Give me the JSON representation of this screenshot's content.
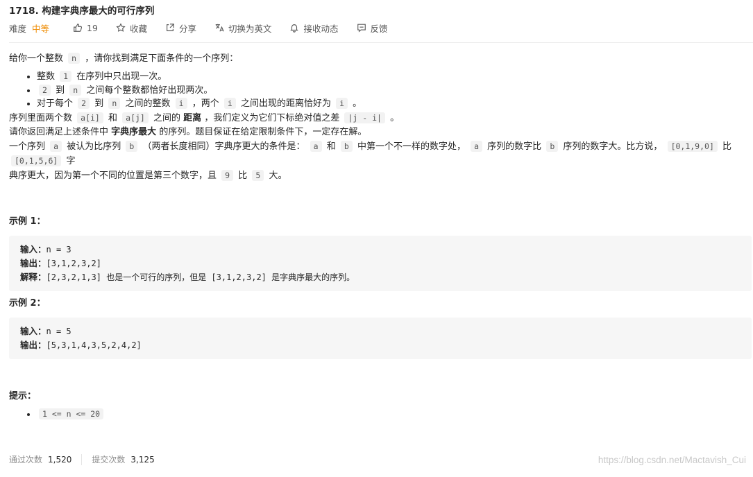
{
  "problem": {
    "title": "1718. 构建字典序最大的可行序列"
  },
  "meta": {
    "difficulty_label": "难度",
    "difficulty_value": "中等",
    "likes": "19",
    "favorite": "收藏",
    "share": "分享",
    "switch_lang": "切换为英文",
    "notifications": "接收动态",
    "feedback": "反馈",
    "colors": {
      "difficulty": "#ef8b00"
    }
  },
  "desc": {
    "intro_a": "给你一个整数",
    "intro_code": "n",
    "intro_b": "，请你找到满足下面条件的一个序列：",
    "bullets": {
      "b1_a": "整数",
      "b1_code": "1",
      "b1_b": "在序列中只出现一次。",
      "b2_code1": "2",
      "b2_a": "到",
      "b2_code2": "n",
      "b2_b": "之间每个整数都恰好出现两次。",
      "b3_a": "对于每个",
      "b3_code1": "2",
      "b3_b": "到",
      "b3_code2": "n",
      "b3_c": "之间的整数",
      "b3_code3": "i",
      "b3_d": "，两个",
      "b3_code4": "i",
      "b3_e": "之间出现的距离恰好为",
      "b3_code5": "i",
      "b3_f": "。"
    },
    "seq_a": "序列里面两个数",
    "seq_code1": "a[i]",
    "seq_b": "和",
    "seq_code2": "a[j]",
    "seq_c": "之间的",
    "seq_strong": "距离",
    "seq_d": "，我们定义为它们下标绝对值之差",
    "seq_code3": "|j - i|",
    "seq_e": "。",
    "ret_a": "请你返回满足上述条件中",
    "ret_strong": "字典序最大",
    "ret_b": "的序列。题目保证在给定限制条件下，一定存在解。",
    "def_a": "一个序列",
    "def_code1": "a",
    "def_b": "被认为比序列",
    "def_code2": "b",
    "def_c": "（两者长度相同）字典序更大的条件是：",
    "def_code3": "a",
    "def_d": "和",
    "def_code4": "b",
    "def_e": "中第一个不一样的数字处，",
    "def_code5": "a",
    "def_f": "序列的数字比",
    "def_code6": "b",
    "def_g": "序列的数字大。比方说，",
    "def_code7": "[0,1,9,0]",
    "def_h": "比",
    "def_code8": "[0,1,5,6]",
    "def_i": "字",
    "def2_a": "典序更大，因为第一个不同的位置是第三个数字，且",
    "def2_code1": "9",
    "def2_b": "比",
    "def2_code2": "5",
    "def2_c": "大。"
  },
  "examples": {
    "ex1_title": "示例 1：",
    "ex1_in_k": "输入：",
    "ex1_in_v": "n = 3",
    "ex1_out_k": "输出：",
    "ex1_out_v": "[3,1,2,3,2]",
    "ex1_exp_k": "解释：",
    "ex1_exp_v": "[2,3,2,1,3] 也是一个可行的序列，但是 [3,1,2,3,2] 是字典序最大的序列。",
    "ex2_title": "示例 2：",
    "ex2_in_k": "输入：",
    "ex2_in_v": "n = 5",
    "ex2_out_k": "输出：",
    "ex2_out_v": "[5,3,1,4,3,5,2,4,2]"
  },
  "hints": {
    "title": "提示：",
    "h1": "1 <= n <= 20"
  },
  "footer": {
    "accepted_label": "通过次数",
    "accepted_value": "1,520",
    "submitted_label": "提交次数",
    "submitted_value": "3,125"
  },
  "watermark": "https://blog.csdn.net/Mactavish_Cui"
}
